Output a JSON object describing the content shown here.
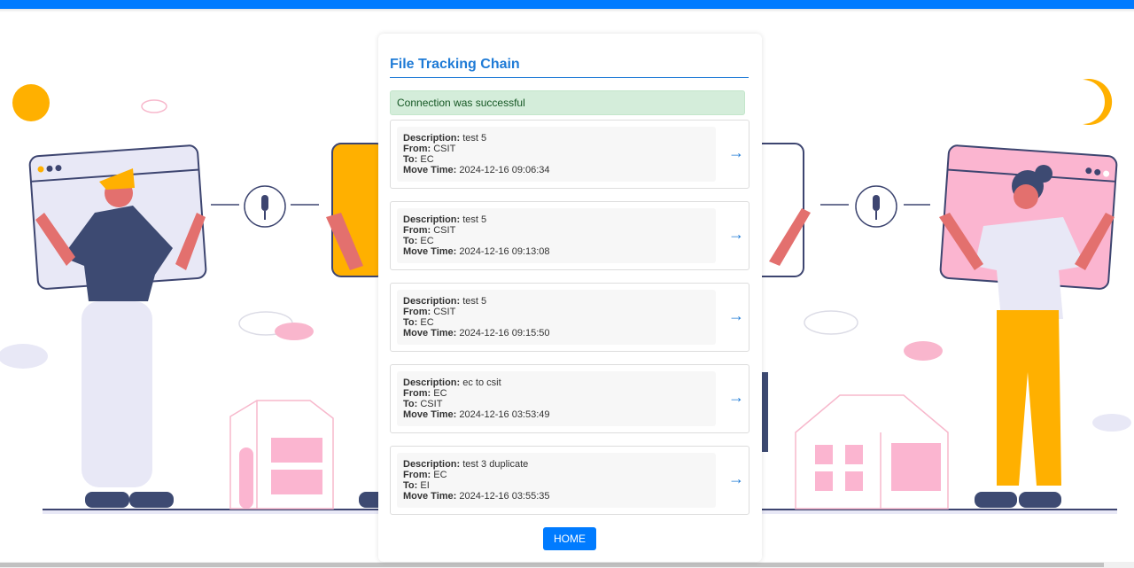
{
  "page": {
    "title": "File Tracking Chain",
    "alert": "Connection was successful",
    "home_label": "HOME",
    "arrow_glyph": "→"
  },
  "labels": {
    "description": "Description:",
    "from": "From:",
    "to": "To:",
    "move_time": "Move Time:"
  },
  "entries": [
    {
      "description": "test 5",
      "from": "CSIT",
      "to": "EC",
      "move_time": "2024-12-16 09:06:34"
    },
    {
      "description": "test 5",
      "from": "CSIT",
      "to": "EC",
      "move_time": "2024-12-16 09:13:08"
    },
    {
      "description": "test 5",
      "from": "CSIT",
      "to": "EC",
      "move_time": "2024-12-16 09:15:50"
    },
    {
      "description": "ec to csit",
      "from": "EC",
      "to": "CSIT",
      "move_time": "2024-12-16 03:53:49"
    },
    {
      "description": "test 3 duplicate",
      "from": "EC",
      "to": "EI",
      "move_time": "2024-12-16 03:55:35"
    }
  ],
  "colors": {
    "accent": "#007bff",
    "title": "#1f7bd6",
    "alert_bg": "#d4edda",
    "alert_text": "#155724"
  },
  "icons": {
    "arrow": "right-arrow-icon",
    "mic": "microphone-icon"
  }
}
